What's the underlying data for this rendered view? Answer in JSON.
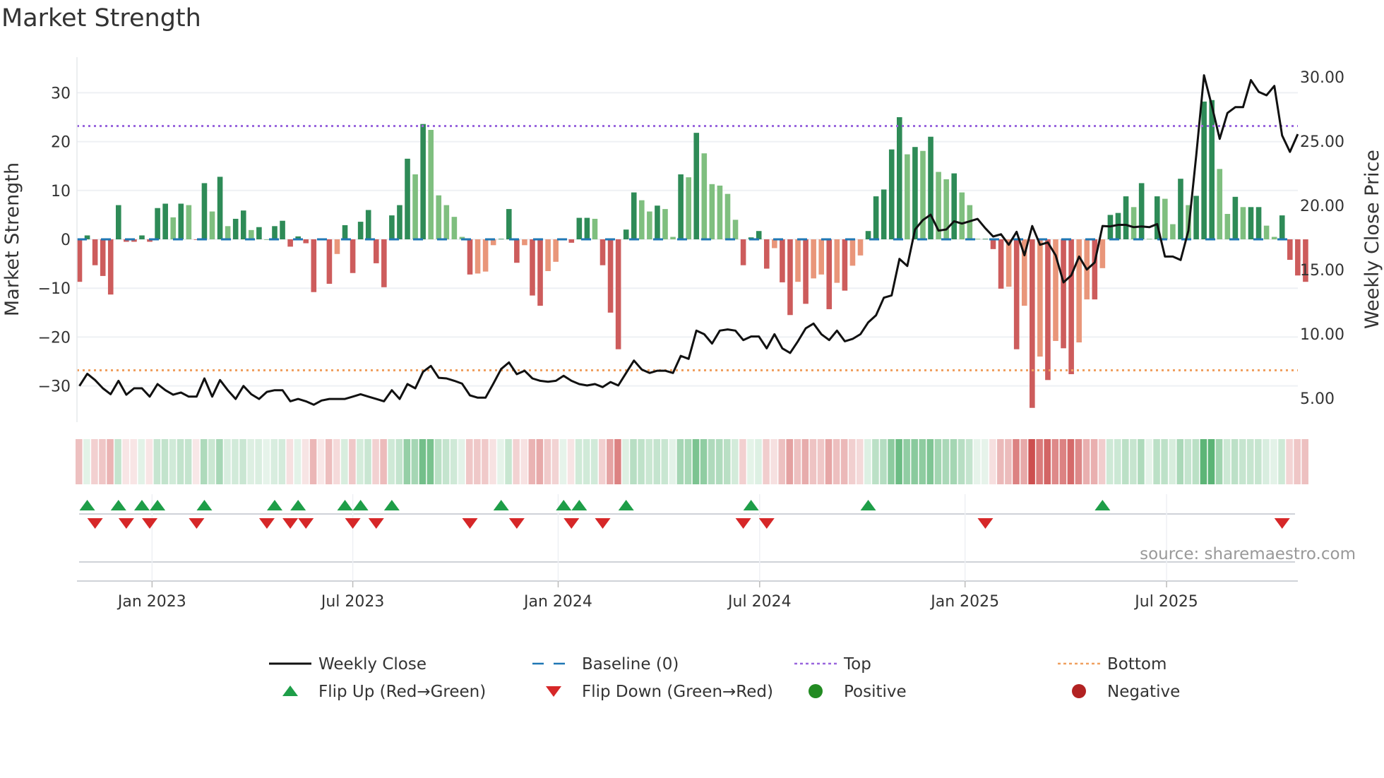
{
  "title": "Market Strength",
  "source": "source: sharemaestro.com",
  "colors": {
    "strong_pos": "#2e8b57",
    "weak_pos": "#7fbf7f",
    "strong_neg": "#cd5c5c",
    "weak_neg": "#e9967a",
    "price": "#111111",
    "baseline": "#1f77b4",
    "top": "#9966dd",
    "bottom": "#f0a060",
    "flip_up": "#1e9e48",
    "flip_down": "#d62728",
    "positive": "#228b22",
    "negative": "#b22222"
  },
  "chart_data": {
    "type": "bar",
    "title": "Market Strength",
    "ylabel": "Market Strength",
    "y2label": "Weekly Close Price",
    "ylim": [
      -36,
      40
    ],
    "y2lim": [
      3.0,
      32.0
    ],
    "yticks": [
      {
        "v": 30,
        "label": "30"
      },
      {
        "v": 20,
        "label": "20"
      },
      {
        "v": 10,
        "label": "10"
      },
      {
        "v": 0,
        "label": "0"
      },
      {
        "v": -10,
        "label": "−10"
      },
      {
        "v": -20,
        "label": "−20"
      },
      {
        "v": -30,
        "label": "−30"
      }
    ],
    "y2ticks": [
      {
        "v": 30,
        "label": "30.00"
      },
      {
        "v": 25,
        "label": "25.00"
      },
      {
        "v": 20,
        "label": "20.00"
      },
      {
        "v": 15,
        "label": "15.00"
      },
      {
        "v": 10,
        "label": "10.00"
      },
      {
        "v": 5,
        "label": "5.00"
      }
    ],
    "xticks": [
      {
        "week": 9.3,
        "label": "Jan 2023"
      },
      {
        "week": 35.0,
        "label": "Jul 2023"
      },
      {
        "week": 61.3,
        "label": "Jan 2024"
      },
      {
        "week": 87.1,
        "label": "Jul 2024"
      },
      {
        "week": 113.4,
        "label": "Jan 2025"
      },
      {
        "week": 139.2,
        "label": "Jul 2025"
      }
    ],
    "top": 23.2,
    "bottom": -26.8,
    "baseline": 0,
    "strength": [
      -8.7,
      0.8,
      -5.3,
      -7.5,
      -11.3,
      7,
      -0.5,
      -0.5,
      0.8,
      -0.5,
      6.4,
      7.3,
      4.5,
      7.3,
      7,
      -0.1,
      11.5,
      5.7,
      12.8,
      2.7,
      4.2,
      5.9,
      1.9,
      2.5,
      0,
      2.7,
      3.8,
      -1.5,
      0.6,
      -0.8,
      -10.8,
      -0.2,
      -9.1,
      -3,
      2.9,
      -6.9,
      3.6,
      6,
      -4.9,
      -9.8,
      4.9,
      7,
      16.5,
      13.3,
      23.6,
      22.4,
      9,
      7,
      4.6,
      0.5,
      -7.2,
      -7,
      -6.6,
      -1.2,
      0.1,
      6.2,
      -4.8,
      -1.2,
      -11.5,
      -13.6,
      -6.5,
      -4.6,
      0.1,
      -0.7,
      4.4,
      4.4,
      4.2,
      -5.3,
      -15,
      -22.5,
      2,
      9.6,
      8,
      5.7,
      6.9,
      6.2,
      0.5,
      13.3,
      12.7,
      21.8,
      17.6,
      11.3,
      11,
      9.3,
      4,
      -5.3,
      0.4,
      1.7,
      -6,
      -1.8,
      -8.8,
      -15.5,
      -8.7,
      -13.2,
      -8,
      -7.2,
      -14.3,
      -8.9,
      -10.5,
      -5.4,
      -3.3,
      1.7,
      8.8,
      10.2,
      18.4,
      25,
      17.4,
      18.9,
      18.1,
      21,
      13.8,
      12.3,
      13.5,
      9.6,
      7,
      0.1,
      0.1,
      -2,
      -10.1,
      -9.7,
      -22.5,
      -13.6,
      -34.5,
      -24,
      -28.8,
      -20.8,
      -22.3,
      -27.6,
      -21.1,
      -12.3,
      -12.3,
      -5.9,
      5,
      5.4,
      8.8,
      6.6,
      11.5,
      0.1,
      8.8,
      8.3,
      3.1,
      12.4,
      7,
      8.9,
      28.2,
      28.5,
      14.4,
      5.2,
      8.7,
      6.6,
      6.6,
      6.6,
      2.8,
      0.5,
      4.9,
      -4.2,
      -7.4,
      -8.7
    ],
    "weekly_close": [
      5.95,
      6.9,
      6.41,
      5.77,
      5.31,
      6.35,
      5.27,
      5.77,
      5.77,
      5.12,
      6.1,
      5.62,
      5.27,
      5.44,
      5.12,
      5.12,
      6.54,
      5.12,
      6.41,
      5.62,
      4.94,
      5.95,
      5.31,
      4.94,
      5.49,
      5.62,
      5.62,
      4.76,
      4.94,
      4.76,
      4.49,
      4.82,
      4.94,
      4.94,
      4.94,
      5.12,
      5.31,
      5.12,
      4.94,
      4.76,
      5.62,
      4.94,
      6.1,
      5.77,
      7.05,
      7.51,
      6.59,
      6.54,
      6.35,
      6.13,
      5.22,
      5.04,
      5.04,
      6.13,
      7.27,
      7.78,
      6.87,
      7.14,
      6.54,
      6.35,
      6.28,
      6.35,
      6.74,
      6.35,
      6.1,
      5.99,
      6.1,
      5.86,
      6.26,
      5.99,
      6.96,
      7.93,
      7.23,
      6.96,
      7.14,
      7.14,
      6.96,
      8.29,
      8.06,
      10.26,
      9.98,
      9.25,
      10.26,
      10.35,
      10.26,
      9.52,
      9.8,
      9.8,
      8.88,
      9.98,
      8.88,
      8.52,
      9.43,
      10.44,
      10.81,
      9.98,
      9.52,
      10.26,
      9.43,
      9.61,
      9.98,
      10.9,
      11.45,
      12.82,
      13.0,
      15.84,
      15.29,
      18.13,
      18.86,
      19.28,
      18.04,
      18.13,
      18.77,
      18.59,
      18.77,
      18.95,
      18.22,
      17.58,
      17.76,
      16.94,
      17.95,
      16.12,
      18.4,
      16.94,
      17.12,
      16.12,
      14.01,
      14.56,
      16.02,
      15.01,
      15.56,
      18.4,
      18.37,
      18.49,
      18.49,
      18.31,
      18.37,
      18.31,
      18.55,
      16.02,
      16.02,
      15.75,
      18.04,
      23.9,
      30.13,
      27.75,
      25.18,
      27.19,
      27.65,
      27.65,
      29.76,
      28.84,
      28.57,
      29.3,
      25.45,
      24.17,
      25.55
    ],
    "flip_up_weeks": [
      1,
      5,
      8,
      10,
      16,
      25,
      28,
      34,
      36,
      40,
      54,
      62,
      64,
      70,
      86,
      101,
      131
    ],
    "flip_down_weeks": [
      2,
      6,
      9,
      15,
      24,
      27,
      29,
      35,
      38,
      50,
      56,
      63,
      67,
      85,
      88,
      116,
      154
    ],
    "legend": {
      "placement": "bottom",
      "items": [
        {
          "label": "Weekly Close",
          "kind": "line"
        },
        {
          "label": "Baseline (0)",
          "kind": "dash"
        },
        {
          "label": "Top",
          "kind": "dot-top"
        },
        {
          "label": "Bottom",
          "kind": "dot-bottom"
        },
        {
          "label": "Flip Up (Red→Green)",
          "kind": "tri-up"
        },
        {
          "label": "Flip Down (Green→Red)",
          "kind": "tri-down"
        },
        {
          "label": "Positive",
          "kind": "circle-pos"
        },
        {
          "label": "Negative",
          "kind": "circle-neg"
        }
      ]
    }
  }
}
